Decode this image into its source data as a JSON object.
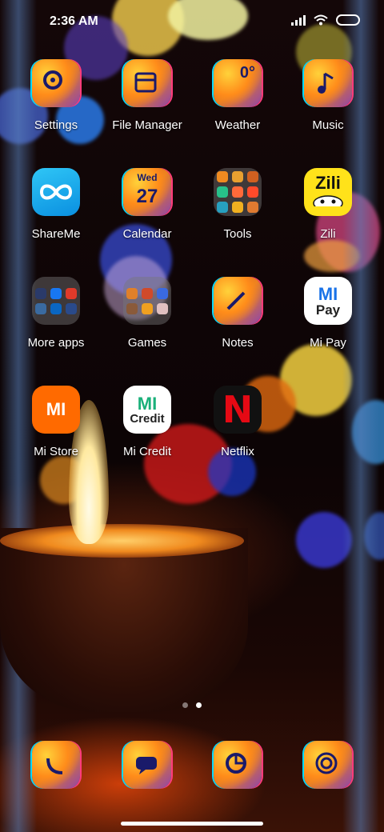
{
  "status_bar": {
    "time": "2:36 AM",
    "icons": [
      "signal-icon",
      "wifi-icon",
      "battery-icon"
    ]
  },
  "apps": [
    {
      "label": "Settings",
      "icon": "gear-icon"
    },
    {
      "label": "File Manager",
      "icon": "folder-icon"
    },
    {
      "label": "Weather",
      "icon": "weather-icon",
      "glyph": "0°"
    },
    {
      "label": "Music",
      "icon": "music-note-icon"
    },
    {
      "label": "ShareMe",
      "icon": "infinity-icon"
    },
    {
      "label": "Calendar",
      "icon": "calendar-icon",
      "day": "Wed",
      "date": "27"
    },
    {
      "label": "Tools",
      "icon": "tools-folder-icon"
    },
    {
      "label": "Zili",
      "icon": "zili-icon",
      "glyph": "Zili"
    },
    {
      "label": "More apps",
      "icon": "more-apps-folder-icon"
    },
    {
      "label": "Games",
      "icon": "games-folder-icon"
    },
    {
      "label": "Notes",
      "icon": "notes-icon"
    },
    {
      "label": "Mi Pay",
      "icon": "mi-pay-icon",
      "glyph_top": "MI",
      "glyph_bottom": "Pay"
    },
    {
      "label": "Mi Store",
      "icon": "mi-store-icon",
      "glyph": "MI"
    },
    {
      "label": "Mi Credit",
      "icon": "mi-credit-icon",
      "glyph_top": "MI",
      "glyph_bottom": "Credit"
    },
    {
      "label": "Netflix",
      "icon": "netflix-icon",
      "glyph": "N"
    }
  ],
  "page_indicator": {
    "pages": 2,
    "active": 2
  },
  "dock": [
    {
      "icon": "phone-icon"
    },
    {
      "icon": "messages-icon"
    },
    {
      "icon": "browser-icon"
    },
    {
      "icon": "camera-icon"
    }
  ]
}
